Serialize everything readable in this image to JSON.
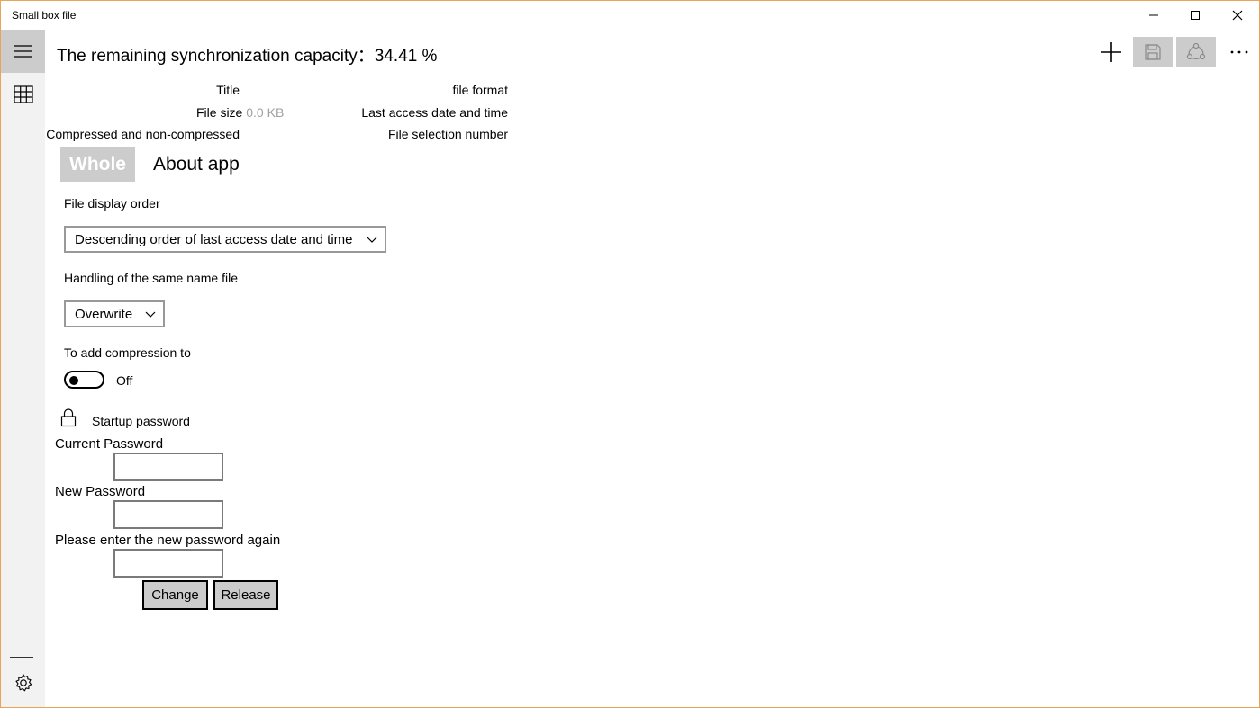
{
  "window": {
    "title": "Small box file",
    "controls": {
      "minimize": "minimize-icon",
      "maximize": "maximize-icon",
      "close": "close-icon"
    }
  },
  "rail": {
    "menu_icon": "hamburger-icon",
    "grid_icon": "grid-icon",
    "settings_icon": "gear-icon"
  },
  "header": {
    "capacity_label": "The remaining synchronization capacity：",
    "capacity_value": "34.41 %",
    "actions": [
      "add-icon",
      "save-icon",
      "share-icon",
      "more-icon"
    ]
  },
  "file_info": {
    "title_label": "Title",
    "file_size_label": "File size",
    "file_size_value": "0.0 KB",
    "compressed_label": "Compressed and non-compressed",
    "file_format_label": "file format",
    "last_access_label": "Last access date and time",
    "selection_number_label": "File selection number"
  },
  "pivot": {
    "whole": "Whole",
    "about": "About app"
  },
  "settings": {
    "display_order_label": "File display order",
    "display_order_value": "Descending order of last access date and time",
    "same_name_label": "Handling of the same name file",
    "same_name_value": "Overwrite",
    "compression_label": "To add compression to",
    "compression_state": "Off",
    "compression_on": false
  },
  "password": {
    "section_label": "Startup password",
    "current_label": "Current Password",
    "new_label": "New Password",
    "confirm_label": "Please enter the new password again",
    "current_value": "",
    "new_value": "",
    "confirm_value": "",
    "change_button": "Change",
    "release_button": "Release"
  },
  "colors": {
    "window_border": "#e8a55a",
    "rail_bg": "#f2f2f2",
    "active_bg": "#cccccc"
  }
}
